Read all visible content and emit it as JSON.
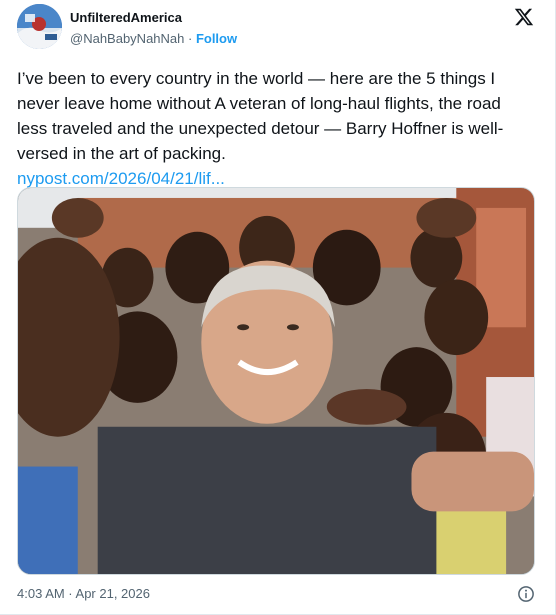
{
  "author": {
    "display_name": "UnfilteredAmerica",
    "handle": "@NahBabyNahNah",
    "separator": " · ",
    "follow_label": "Follow"
  },
  "tweet": {
    "text": "I’ve been to every country in the world — here are the 5 things I never leave home without A veteran of long-haul flights, the road less traveled and the unexpected detour — Barry Hoffner is well-versed in the art of packing.",
    "link": "nypost.com/2026/04/21/lif..."
  },
  "footer": {
    "timestamp": "4:03 AM · Apr 21, 2026"
  },
  "icons": {
    "brand": "x-logo-icon",
    "info": "info-icon"
  },
  "colors": {
    "accent": "#1d9bf0",
    "text": "#0f1419",
    "muted": "#536471"
  }
}
